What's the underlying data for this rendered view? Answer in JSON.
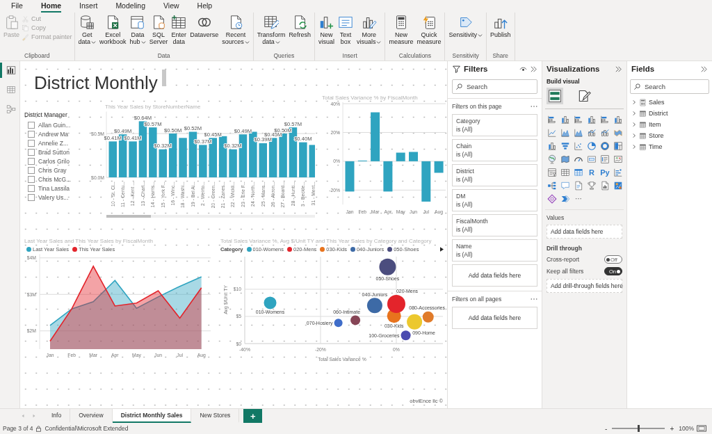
{
  "menu": [
    {
      "label": "File",
      "selected": false
    },
    {
      "label": "Home",
      "selected": true
    },
    {
      "label": "Insert",
      "selected": false
    },
    {
      "label": "Modeling",
      "selected": false
    },
    {
      "label": "View",
      "selected": false
    },
    {
      "label": "Help",
      "selected": false
    }
  ],
  "ribbon": [
    {
      "label": "Clipboard",
      "buttons": [
        {
          "lines": [
            "Paste"
          ],
          "kind": "large",
          "dropdown": false,
          "disabled": true
        },
        {
          "lines": [
            "Cut"
          ],
          "kind": "small",
          "dropdown": false,
          "disabled": true
        },
        {
          "lines": [
            "Copy"
          ],
          "kind": "small",
          "dropdown": false,
          "disabled": true
        },
        {
          "lines": [
            "Format painter"
          ],
          "kind": "small",
          "dropdown": false,
          "disabled": true
        }
      ]
    },
    {
      "label": "Data",
      "buttons": [
        {
          "lines": [
            "Get",
            "data"
          ],
          "kind": "large",
          "dropdown": true,
          "disabled": false
        },
        {
          "lines": [
            "Excel",
            "workbook"
          ],
          "kind": "large",
          "dropdown": false,
          "disabled": false
        },
        {
          "lines": [
            "Data",
            "hub"
          ],
          "kind": "large",
          "dropdown": true,
          "disabled": false
        },
        {
          "lines": [
            "SQL",
            "Server"
          ],
          "kind": "large",
          "dropdown": false,
          "disabled": false
        },
        {
          "lines": [
            "Enter",
            "data"
          ],
          "kind": "large",
          "dropdown": false,
          "disabled": false
        },
        {
          "lines": [
            "Dataverse"
          ],
          "kind": "large",
          "dropdown": false,
          "disabled": false
        },
        {
          "lines": [
            "Recent",
            "sources"
          ],
          "kind": "large",
          "dropdown": true,
          "disabled": false
        }
      ]
    },
    {
      "label": "Queries",
      "buttons": [
        {
          "lines": [
            "Transform",
            "data"
          ],
          "kind": "large",
          "dropdown": true,
          "disabled": false
        },
        {
          "lines": [
            "Refresh"
          ],
          "kind": "large",
          "dropdown": false,
          "disabled": false
        }
      ]
    },
    {
      "label": "Insert",
      "buttons": [
        {
          "lines": [
            "New",
            "visual"
          ],
          "kind": "large",
          "dropdown": false,
          "disabled": false
        },
        {
          "lines": [
            "Text",
            "box"
          ],
          "kind": "large",
          "dropdown": false,
          "disabled": false
        },
        {
          "lines": [
            "More",
            "visuals"
          ],
          "kind": "large",
          "dropdown": true,
          "disabled": false
        }
      ]
    },
    {
      "label": "Calculations",
      "buttons": [
        {
          "lines": [
            "New",
            "measure"
          ],
          "kind": "large",
          "dropdown": false,
          "disabled": false
        },
        {
          "lines": [
            "Quick",
            "measure"
          ],
          "kind": "large",
          "dropdown": false,
          "disabled": false
        }
      ]
    },
    {
      "label": "Sensitivity",
      "buttons": [
        {
          "lines": [
            "Sensitivity"
          ],
          "kind": "large",
          "dropdown": true,
          "disabled": false
        }
      ]
    },
    {
      "label": "Share",
      "buttons": [
        {
          "lines": [
            "Publish"
          ],
          "kind": "large",
          "dropdown": false,
          "disabled": false
        }
      ]
    }
  ],
  "views": [
    {
      "kind": "report",
      "selected": true
    },
    {
      "kind": "data",
      "selected": false
    },
    {
      "kind": "model",
      "selected": false
    }
  ],
  "canvas": {
    "title": "District Monthly",
    "slicer": {
      "title": "District Manager",
      "items": [
        {
          "label": "Allan Guin...",
          "checked": false
        },
        {
          "label": "Andrew Ma",
          "checked": false
        },
        {
          "label": "Annelie Z...",
          "checked": false
        },
        {
          "label": "Brad Sutton",
          "checked": false
        },
        {
          "label": "Carlos Grilo",
          "checked": false
        },
        {
          "label": "Chris Gray",
          "checked": false
        },
        {
          "label": "Chris McG...",
          "checked": false
        },
        {
          "label": "Tina Lassila",
          "checked": false
        },
        {
          "label": "Valery Us...",
          "checked": false
        }
      ]
    },
    "bar_visual": {
      "title": "This Year Sales by StoreNumberName",
      "chart_data": {
        "type": "bar",
        "categories": [
          "10 - St. Cl...",
          "11 - Centu...",
          "12 - Kent ...",
          "13 - Charl...",
          "14 - Harris...",
          "15 - York F...",
          "16 - Winc...",
          "18 - Washi...",
          "19 - Bel Ai...",
          "2 - Weirto...",
          "20 - Green...",
          "21 - Zanes...",
          "22 - Wickli...",
          "23 - Erie F...",
          "24 - North...",
          "25 - Mans...",
          "26 - Akron...",
          "27 - Board...",
          "28 - Hunti...",
          "3 - Beckle...",
          "31 - Ment..."
        ],
        "values": [
          0.41,
          0.49,
          0.41,
          0.64,
          0.57,
          0.32,
          0.5,
          0.45,
          0.52,
          0.37,
          0.45,
          0.47,
          0.32,
          0.49,
          0.52,
          0.39,
          0.45,
          0.5,
          0.57,
          0.4,
          0.37
        ],
        "value_labels": [
          "$0.41M",
          "$0.49M",
          "$0.41M",
          "$0.64M",
          "$0.57M",
          "$0.32M",
          "$0.50M",
          null,
          "$0.52M",
          "$0.37M",
          "$0.45M",
          null,
          "$0.32M",
          "$0.49M",
          null,
          "$0.39M",
          "$0.45M",
          "$0.50M",
          "$0.57M",
          "$0.40M",
          null
        ],
        "grid": true,
        "ylim": [
          0,
          0.75
        ],
        "yticks": [
          {
            "value": 0,
            "label": "$0.0M"
          },
          {
            "value": 0.5,
            "label": "$0.5M"
          }
        ]
      }
    },
    "variance_visual": {
      "title": "Total Sales Variance % by FiscalMonth",
      "chart_data": {
        "type": "bar",
        "categories": [
          "Jan",
          "Feb",
          "Mar",
          "Apr",
          "May",
          "Jun",
          "Jul",
          "Aug"
        ],
        "values": [
          -21,
          0.5,
          34,
          -21,
          6,
          6.5,
          -28,
          -8
        ],
        "grid": true,
        "ylim": [
          -30,
          41
        ],
        "yticks": [
          {
            "value": -20,
            "label": "-20%"
          },
          {
            "value": 0,
            "label": "0%"
          },
          {
            "value": 20,
            "label": "20%"
          },
          {
            "value": 40,
            "label": "40%"
          }
        ]
      }
    },
    "area_visual": {
      "title": "Last Year Sales and This Year Sales by FiscalMonth",
      "chart_data": {
        "type": "area",
        "categories": [
          "Jan",
          "Feb",
          "Mar",
          "Apr",
          "May",
          "Jun",
          "Jul",
          "Aug"
        ],
        "grid": true,
        "ylim": [
          1.5,
          4.1
        ],
        "yticks": [
          {
            "value": 2,
            "label": "$2M"
          },
          {
            "value": 3,
            "label": "$3M"
          },
          {
            "value": 4,
            "label": "$4M"
          }
        ],
        "series": [
          {
            "name": "Last Year Sales",
            "color": "#2fa4c0",
            "values": [
              2.15,
              2.6,
              2.8,
              3.38,
              2.62,
              2.93,
              3.22,
              3.48
            ]
          },
          {
            "name": "This Year Sales",
            "color": "#e3242b",
            "values": [
              1.72,
              2.6,
              3.77,
              2.68,
              2.76,
              3.1,
              2.35,
              3.18
            ]
          }
        ]
      }
    },
    "scatter_visual": {
      "title": "Total Sales Variance %, Avg $/Unit TY and This Year Sales by Category and Category",
      "legend_title": "Category",
      "legend": [
        {
          "name": "010-Womens",
          "color": "#2fa4c0"
        },
        {
          "name": "020-Mens",
          "color": "#e3242b"
        },
        {
          "name": "030-Kids",
          "color": "#e8731d"
        },
        {
          "name": "040-Juniors",
          "color": "#3d6aa6"
        },
        {
          "name": "050-Shoes",
          "color": "#4b4d7e"
        }
      ],
      "chart_data": {
        "type": "scatter",
        "xlabel": "Total Sales Variance %",
        "ylabel": "Avg $/Unit TY",
        "grid": true,
        "xlim": [
          -40,
          12.3
        ],
        "ylim": [
          0,
          16
        ],
        "xticks": [
          {
            "value": -40,
            "label": "-40%"
          },
          {
            "value": -20,
            "label": "-20%"
          },
          {
            "value": 0,
            "label": "0%"
          }
        ],
        "yticks": [
          {
            "value": 0,
            "label": "$0"
          },
          {
            "value": 5,
            "label": "$5"
          },
          {
            "value": 10,
            "label": "$10"
          }
        ],
        "series": [
          {
            "name": "050-Shoes",
            "color": "#4b4d7e",
            "x": [
              -2.3
            ],
            "values": [
              14.1
            ]
          },
          {
            "name": "010-Womens",
            "color": "#2fa4c0",
            "x": [
              -33.3
            ],
            "values": [
              7.5
            ]
          },
          {
            "name": "040-Juniors",
            "color": "#3d6aa6",
            "x": [
              -5.7
            ],
            "values": [
              7.0
            ]
          },
          {
            "name": "060-Intimate",
            "color": "#864556",
            "x": [
              -10.8
            ],
            "values": [
              4.3
            ]
          },
          {
            "name": "070-Hosiery",
            "color": "#3f6dc9",
            "x": [
              -15.3
            ],
            "values": [
              3.8
            ]
          },
          {
            "name": "080-Accessories",
            "color": "#e07b2a",
            "x": [
              8.4
            ],
            "values": [
              4.9
            ]
          },
          {
            "name": "030-Kids",
            "color": "#e8731d",
            "x": [
              -0.6
            ],
            "values": [
              5.1
            ]
          },
          {
            "name": "020-Mens",
            "color": "#e3242b",
            "x": [
              0
            ],
            "values": [
              7.3
            ]
          },
          {
            "name": "090-Home",
            "color": "#ecc82e",
            "x": [
              4.8
            ],
            "values": [
              4.0
            ]
          },
          {
            "name": "100-Groceries",
            "color": "#4b4bb0",
            "x": [
              2.5
            ],
            "values": [
              1.5
            ]
          }
        ]
      }
    },
    "credit": "obviEnce llc ©"
  },
  "filters": {
    "title": "Filters",
    "search": {
      "placeholder": "Search"
    },
    "page_section": "Filters on this page",
    "cards": [
      {
        "name": "Category",
        "value": "is (All)"
      },
      {
        "name": "Chain",
        "value": "is (All)"
      },
      {
        "name": "District",
        "value": "is (All)"
      },
      {
        "name": "DM",
        "value": "is (All)"
      },
      {
        "name": "FiscalMonth",
        "value": "is (All)"
      },
      {
        "name": "Name",
        "value": "is (All)"
      }
    ],
    "page_drop": "Add data fields here",
    "all_section": "Filters on all pages",
    "all_drop": "Add data fields here"
  },
  "visualizations": {
    "title": "Visualizations",
    "build_label": "Build visual",
    "build_tabs": [
      {
        "kind": "fields",
        "selected": true
      },
      {
        "kind": "format",
        "selected": false
      }
    ],
    "glyph_visuals": [
      "R",
      "Py"
    ],
    "more": "···",
    "values_label": "Values",
    "values_drop": "Add data fields here",
    "drill_title": "Drill through",
    "toggles": [
      {
        "label": "Cross-report",
        "on": false,
        "text": "Off"
      },
      {
        "label": "Keep all filters",
        "on": true,
        "text": "On"
      }
    ],
    "drill_drop": "Add drill-through fields here"
  },
  "fields": {
    "title": "Fields",
    "search": {
      "placeholder": "Search"
    },
    "tables": [
      {
        "kind": "measure",
        "label": "Sales",
        "expanded": false
      },
      {
        "kind": "table",
        "label": "District",
        "expanded": false
      },
      {
        "kind": "table",
        "label": "Item",
        "expanded": false
      },
      {
        "kind": "table",
        "label": "Store",
        "expanded": false
      },
      {
        "kind": "table",
        "label": "Time",
        "expanded": false
      }
    ]
  },
  "page_tabs": {
    "tabs": [
      {
        "label": "Info",
        "selected": false
      },
      {
        "label": "Overview",
        "selected": false
      },
      {
        "label": "District Monthly Sales",
        "selected": true
      },
      {
        "label": "New Stores",
        "selected": false
      }
    ],
    "add": "+"
  },
  "status_bar": {
    "page": "Page 3 of 4",
    "sensitivity": "Confidential\\Microsoft Extended",
    "zoom_out": "-",
    "zoom_slider": {
      "level": 0.5
    },
    "zoom_in": "+",
    "zoom": "100%"
  }
}
